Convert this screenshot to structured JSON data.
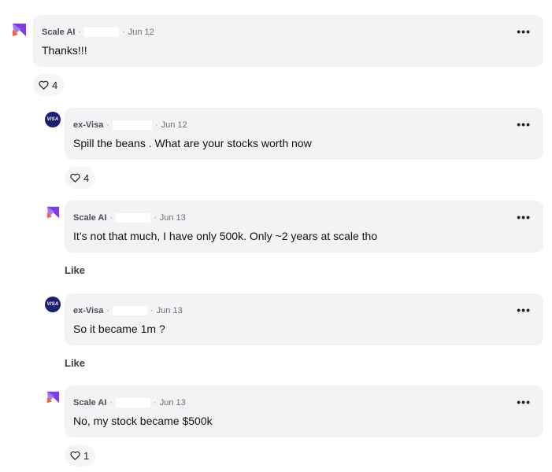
{
  "comments": [
    {
      "company": "Scale AI",
      "date": "Jun 12",
      "text": "Thanks!!!",
      "likes": "4",
      "more": "•••"
    },
    {
      "company": "ex-Visa",
      "date": "Jun 12",
      "text": "Spill the beans . What are your stocks worth now",
      "likes": "4",
      "more": "•••",
      "avatar_label": "VISA"
    },
    {
      "company": "Scale AI",
      "date": "Jun 13",
      "text": "It’s not that much, I have only 500k. Only ~2 years at scale tho",
      "like_label": "Like",
      "more": "•••"
    },
    {
      "company": "ex-Visa",
      "date": "Jun 13",
      "text": "So it became 1m ?",
      "like_label": "Like",
      "more": "•••",
      "avatar_label": "VISA"
    },
    {
      "company": "Scale AI",
      "date": "Jun 13",
      "text": "No, my stock became $500k",
      "likes": "1",
      "more": "•••"
    }
  ],
  "separator": "·",
  "colors": {
    "bubble": "#f2f3f5",
    "scale_logo_primary": "#7b3fe4",
    "scale_logo_accent": "#f0643a",
    "visa_blue": "#1a1f71"
  },
  "icons": [
    "scale-ai-logo-icon",
    "visa-logo-icon",
    "heart-icon",
    "more-dots-icon"
  ]
}
